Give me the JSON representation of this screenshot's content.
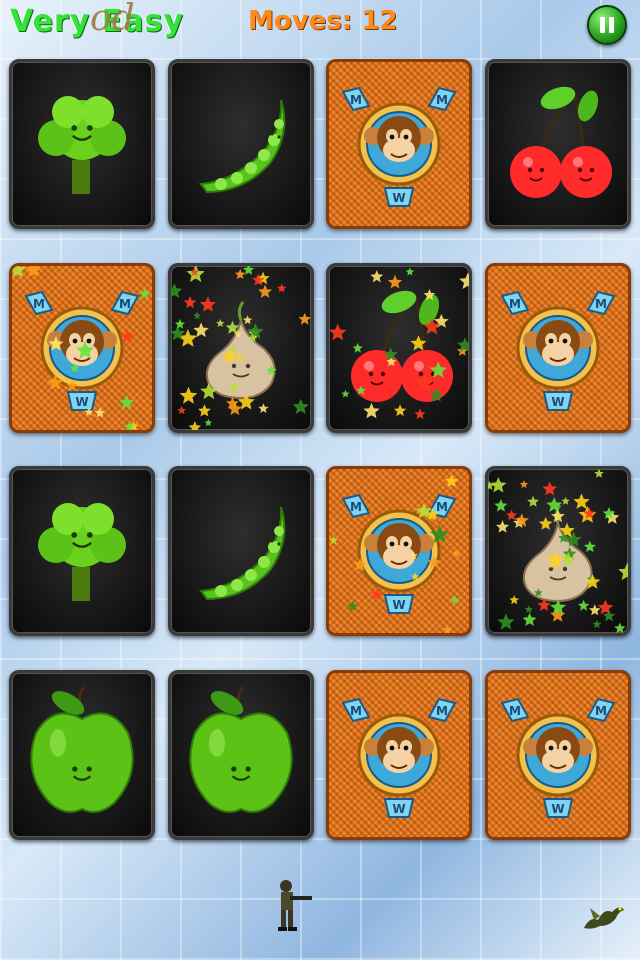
{
  "hud": {
    "difficulty": "Very Easy",
    "scribble": "od",
    "moves_label": "Moves:",
    "moves_value": "12",
    "pause_icon": "pause-icon"
  },
  "colors": {
    "title": "#35e23a",
    "moves": "#ff8a1c",
    "card_back": "#e0701c",
    "card_face": "#141414"
  },
  "board": {
    "rows": [
      [
        {
          "state": "face",
          "item": "broccoli"
        },
        {
          "state": "face",
          "item": "pea-pod"
        },
        {
          "state": "back",
          "item": "monkey-card-back"
        },
        {
          "state": "face",
          "item": "cherries"
        }
      ],
      [
        {
          "state": "back",
          "item": "monkey-card-back"
        },
        {
          "state": "face",
          "item": "onion"
        },
        {
          "state": "face",
          "item": "cherries"
        },
        {
          "state": "back",
          "item": "monkey-card-back"
        }
      ],
      [
        {
          "state": "face",
          "item": "broccoli"
        },
        {
          "state": "face",
          "item": "pea-pod"
        },
        {
          "state": "back",
          "item": "monkey-card-back"
        },
        {
          "state": "face",
          "item": "onion"
        }
      ],
      [
        {
          "state": "face",
          "item": "green-apple"
        },
        {
          "state": "face",
          "item": "green-apple"
        },
        {
          "state": "back",
          "item": "monkey-card-back"
        },
        {
          "state": "back",
          "item": "monkey-card-back"
        }
      ]
    ]
  },
  "decor": {
    "soldier": "soldier-sprite",
    "dragon": "dragon-sprite"
  }
}
